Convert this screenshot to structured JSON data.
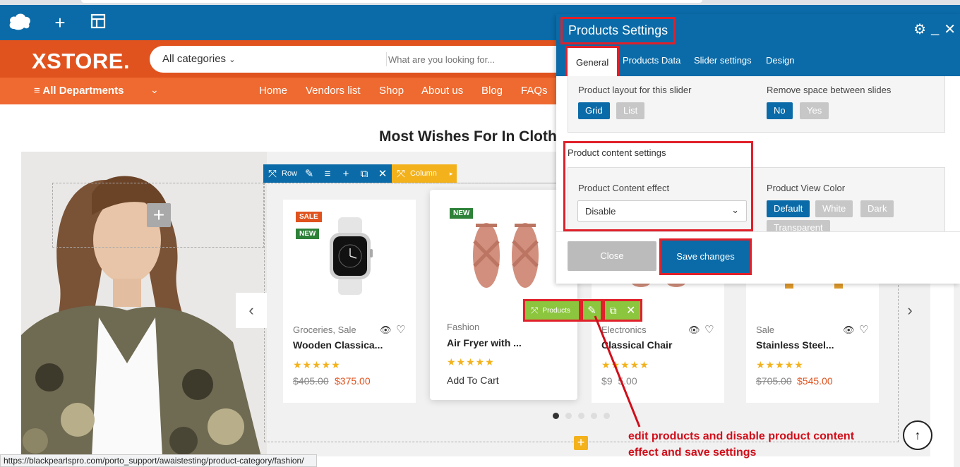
{
  "site": {
    "logo": "XSTORE.",
    "search_category": "All categories",
    "search_placeholder": "What are you looking for...",
    "departments_label": "All Departments",
    "nav": [
      "Home",
      "Vendors list",
      "Shop",
      "About us",
      "Blog",
      "FAQs"
    ]
  },
  "section_title": "Most Wishes For In Clothi",
  "builder_toolbar": {
    "row_label": "Row",
    "column_label": "Column",
    "products_label": "Products"
  },
  "products": [
    {
      "badges": [
        "SALE",
        "NEW"
      ],
      "category": "Groceries, Sale",
      "title": "Wooden Classica...",
      "old_price": "$405.00",
      "price": "$375.00"
    },
    {
      "badges": [
        "NEW"
      ],
      "category": "Fashion",
      "title": "Air Fryer with ...",
      "cta": "Add To Cart"
    },
    {
      "badges": [],
      "category": "Electronics",
      "title": "Classical Chair",
      "price": "$9",
      "price_tail": "5.00"
    },
    {
      "badges": [],
      "category": "Sale",
      "title": "Stainless Steel...",
      "old_price": "$705.00",
      "price": "$545.00"
    }
  ],
  "stars": "★★★★★",
  "modal": {
    "title": "Products Settings",
    "tabs": [
      "General",
      "Products Data",
      "Slider settings",
      "Design"
    ],
    "product_layout_label": "Product layout for this slider",
    "layout_options": [
      "Grid",
      "List"
    ],
    "remove_space_label": "Remove space between slides",
    "space_options": [
      "No",
      "Yes"
    ],
    "content_settings_label": "Product content settings",
    "content_effect_label": "Product Content effect",
    "content_effect_value": "Disable",
    "view_color_label": "Product View Color",
    "view_color_options": [
      "Default",
      "White",
      "Dark",
      "Transparent"
    ],
    "close_label": "Close",
    "save_label": "Save changes"
  },
  "annotation": {
    "line1": "edit products and disable product content",
    "line2": "effect and save settings"
  },
  "status_url": "https://blackpearlspro.com/porto_support/awaistesting/product-category/fashion/",
  "colors": {
    "builder_blue": "#0a6ba8",
    "header_orange": "#e0531e",
    "nav_orange": "#ef6a30",
    "highlight_red": "#e0202a",
    "products_green": "#8cc63f",
    "column_yellow": "#f3b21c"
  }
}
